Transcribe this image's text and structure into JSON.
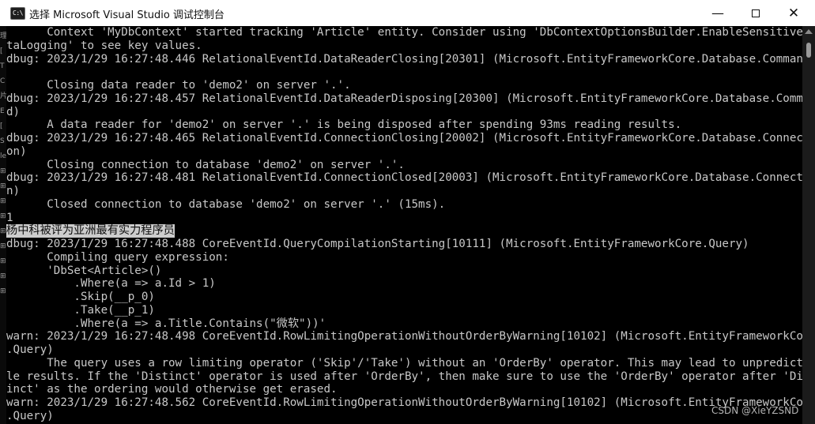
{
  "window": {
    "title": "选择 Microsoft Visual Studio 调试控制台",
    "icon": "console-app-icon",
    "icon_text": "C:\\"
  },
  "console": {
    "lines": [
      "      Context 'MyDbContext' started tracking 'Article' entity. Consider using 'DbContextOptionsBuilder.EnableSensitiveDa",
      "taLogging' to see key values.",
      "dbug: 2023/1/29 16:27:48.446 RelationalEventId.DataReaderClosing[20301] (Microsoft.EntityFrameworkCore.Database.Command)",
      "",
      "      Closing data reader to 'demo2' on server '.'.",
      "dbug: 2023/1/29 16:27:48.457 RelationalEventId.DataReaderDisposing[20300] (Microsoft.EntityFrameworkCore.Database.Comman",
      "d)",
      "      A data reader for 'demo2' on server '.' is being disposed after spending 93ms reading results.",
      "dbug: 2023/1/29 16:27:48.465 RelationalEventId.ConnectionClosing[20002] (Microsoft.EntityFrameworkCore.Database.Connecti",
      "on)",
      "      Closing connection to database 'demo2' on server '.'.",
      "dbug: 2023/1/29 16:27:48.481 RelationalEventId.ConnectionClosed[20003] (Microsoft.EntityFrameworkCore.Database.Connectio",
      "n)",
      "      Closed connection to database 'demo2' on server '.' (15ms).",
      "1",
      "杨中科被评为亚洲最有实力程序员",
      "dbug: 2023/1/29 16:27:48.488 CoreEventId.QueryCompilationStarting[10111] (Microsoft.EntityFrameworkCore.Query)",
      "      Compiling query expression:",
      "      'DbSet<Article>()",
      "          .Where(a => a.Id > 1)",
      "          .Skip(__p_0)",
      "          .Take(__p_1)",
      "          .Where(a => a.Title.Contains(\"微软\"))'",
      "warn: 2023/1/29 16:27:48.498 CoreEventId.RowLimitingOperationWithoutOrderByWarning[10102] (Microsoft.EntityFrameworkCore",
      ".Query)",
      "      The query uses a row limiting operator ('Skip'/'Take') without an 'OrderBy' operator. This may lead to unpredictab",
      "le results. If the 'Distinct' operator is used after 'OrderBy', then make sure to use the 'OrderBy' operator after 'Dist",
      "inct' as the ordering would otherwise get erased.",
      "warn: 2023/1/29 16:27:48.562 CoreEventId.RowLimitingOperationWithoutOrderByWarning[10102] (Microsoft.EntityFrameworkCore",
      ".Query)"
    ],
    "selected_line_index": 15
  },
  "left_strip_glyphs": [
    "理",
    "[",
    "T",
    "C",
    "片",
    "E",
    "[",
    "S",
    "le",
    "⊞",
    "⊞",
    "⊞",
    "⊞",
    "⊞",
    "⊞",
    "⊞",
    "⊞",
    "⊞"
  ],
  "watermark": "CSDN @XieYZSND",
  "colors": {
    "console_background": "#000000",
    "console_text": "#c8c8c8",
    "selection_background": "#cccccc",
    "titlebar_background": "#ffffff"
  }
}
